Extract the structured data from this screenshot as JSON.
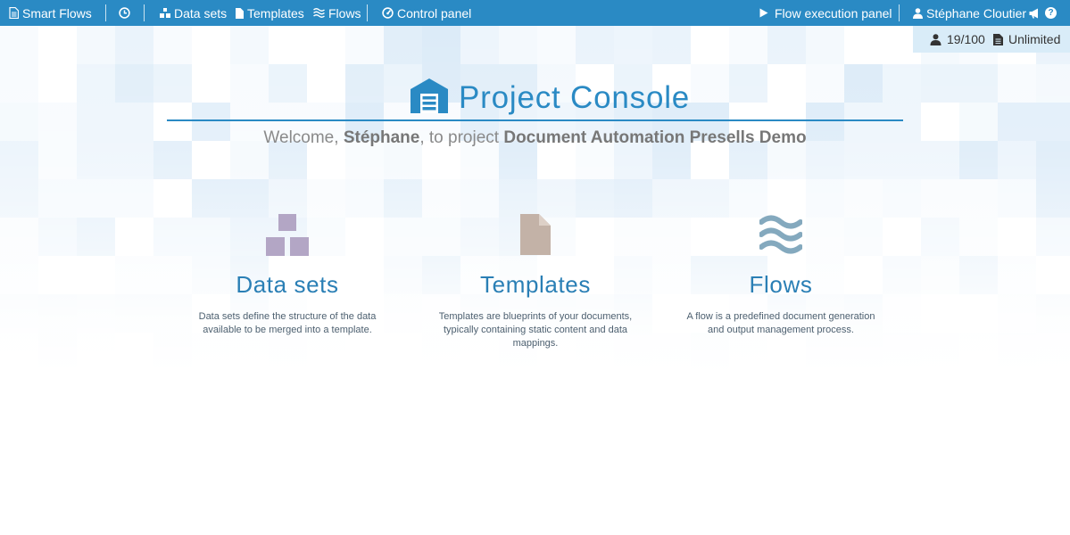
{
  "topbar": {
    "app_title": "Smart Flows",
    "nav": {
      "datasets": "Data sets",
      "templates": "Templates",
      "flows": "Flows",
      "control_panel": "Control panel"
    },
    "flow_execution_panel": "Flow execution panel",
    "user_name": "Stéphane Cloutier",
    "help_badge": "?"
  },
  "quota": {
    "users": "19/100",
    "documents": "Unlimited"
  },
  "header": {
    "title": "Project Console",
    "welcome_prefix": "Welcome,",
    "welcome_user": "Stéphane",
    "welcome_mid": ", to project",
    "project_name": "Document Automation Presells Demo"
  },
  "cards": [
    {
      "title": "Data sets",
      "description": "Data sets define the structure of the data available to be merged into a template."
    },
    {
      "title": "Templates",
      "description": "Templates are blueprints of your documents, typically containing static content and data mappings."
    },
    {
      "title": "Flows",
      "description": "A flow is a predefined document generation and output management process."
    }
  ],
  "colors": {
    "topbar": "#2a8ac4",
    "accent_title": "#2a8ac4",
    "card_title": "#2a7fb5",
    "datasets_icon": "#b3a6c5",
    "templates_icon": "#c3b2a7",
    "flows_icon": "#84a9be",
    "quota_strip": "#d9ecf8"
  },
  "icons": {
    "app": "document-icon",
    "history": "clock-icon",
    "datasets": "sitemap-icon",
    "templates": "file-icon",
    "flows": "waves-icon",
    "control_panel": "gauge-icon",
    "execute": "play-icon",
    "user": "user-icon",
    "notifications": "megaphone-icon",
    "help": "question-icon",
    "console": "warehouse-icon"
  }
}
